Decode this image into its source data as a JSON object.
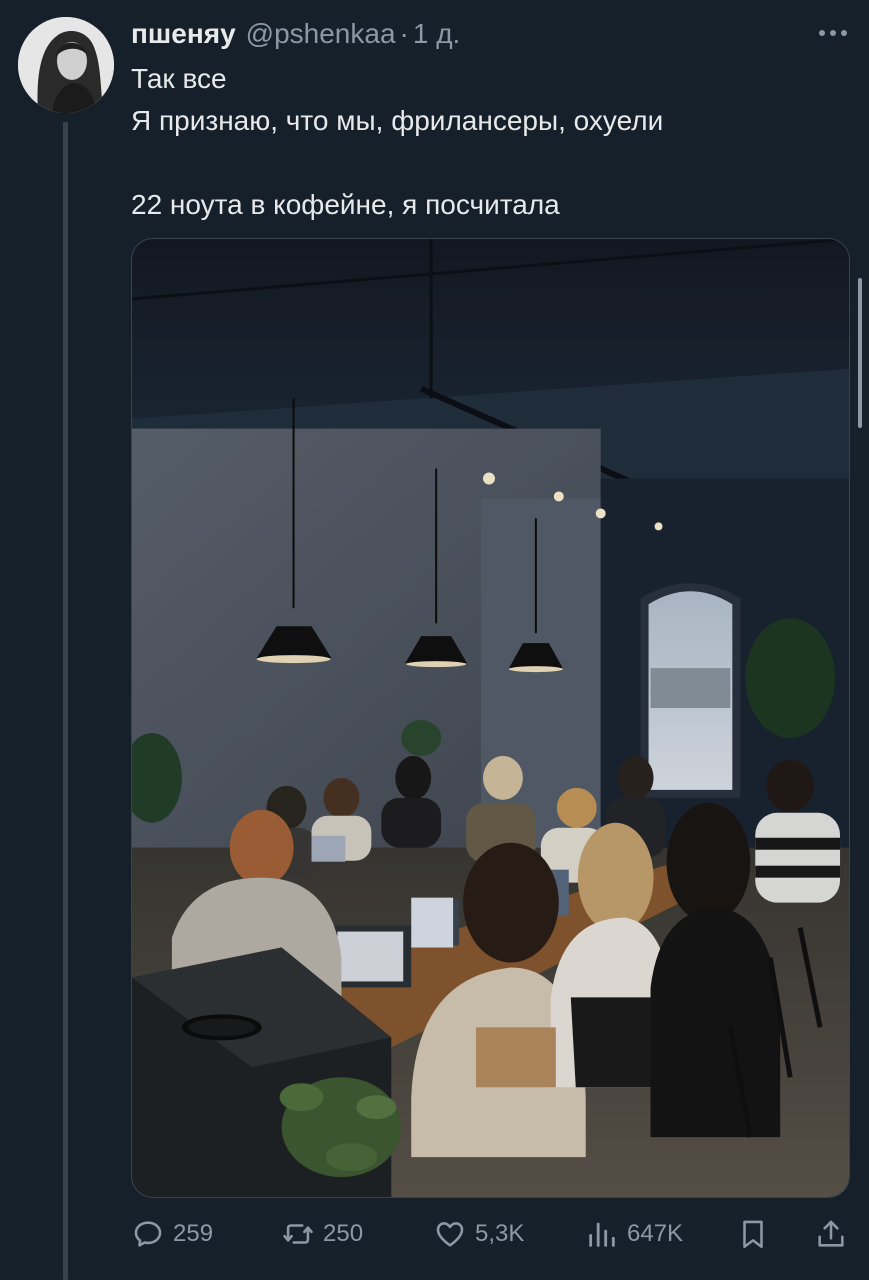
{
  "tweet": {
    "display_name": "пшеняу",
    "handle": "@pshenkaa",
    "separator": "·",
    "time": "1 д.",
    "lines": [
      "Так все",
      "Я признаю, что мы, фрилансеры, охуели",
      "22 ноута в кофейне, я посчитала"
    ]
  },
  "actions": {
    "replies": "259",
    "retweets": "250",
    "likes": "5,3K",
    "views": "647K"
  },
  "icons": [
    "more-icon",
    "reply-icon",
    "retweet-icon",
    "like-icon",
    "views-icon",
    "bookmark-icon",
    "share-icon"
  ],
  "colors": {
    "background": "#15202b",
    "text": "#e7e9ea",
    "secondary": "#8b98a5",
    "thread_line": "#38444d"
  }
}
